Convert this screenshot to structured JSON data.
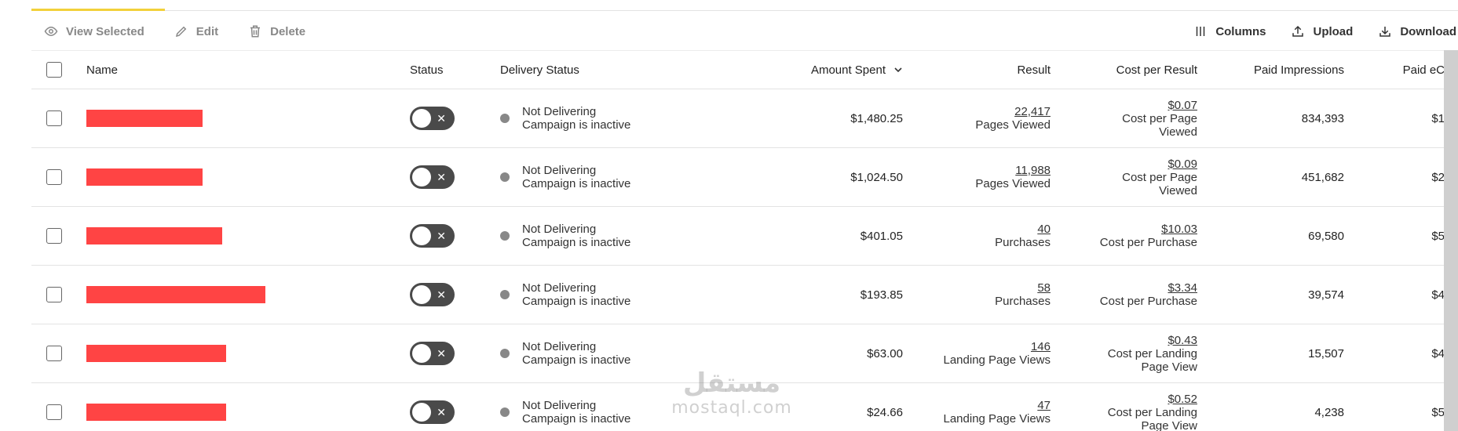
{
  "toolbar": {
    "view_selected": "View Selected",
    "edit": "Edit",
    "delete": "Delete",
    "columns": "Columns",
    "upload": "Upload",
    "download": "Download"
  },
  "columns": {
    "name": "Name",
    "status": "Status",
    "delivery_status": "Delivery Status",
    "amount_spent": "Amount Spent",
    "result": "Result",
    "cost_per_result": "Cost per Result",
    "paid_impressions": "Paid Impressions",
    "paid_ec": "Paid eC"
  },
  "rows": [
    {
      "delivery": "Not Delivering",
      "delivery_sub": "Campaign is inactive",
      "amount": "$1,480.25",
      "result": "22,417",
      "result_type": "Pages Viewed",
      "cpr": "$0.07",
      "cpr_line1": "Cost per Page",
      "cpr_line2": "Viewed",
      "impressions": "834,393",
      "paid_ec": "$1"
    },
    {
      "delivery": "Not Delivering",
      "delivery_sub": "Campaign is inactive",
      "amount": "$1,024.50",
      "result": "11,988",
      "result_type": "Pages Viewed",
      "cpr": "$0.09",
      "cpr_line1": "Cost per Page",
      "cpr_line2": "Viewed",
      "impressions": "451,682",
      "paid_ec": "$2"
    },
    {
      "delivery": "Not Delivering",
      "delivery_sub": "Campaign is inactive",
      "amount": "$401.05",
      "result": "40",
      "result_type": "Purchases",
      "cpr": "$10.03",
      "cpr_line1": "Cost per Purchase",
      "cpr_line2": "",
      "impressions": "69,580",
      "paid_ec": "$5"
    },
    {
      "delivery": "Not Delivering",
      "delivery_sub": "Campaign is inactive",
      "amount": "$193.85",
      "result": "58",
      "result_type": "Purchases",
      "cpr": "$3.34",
      "cpr_line1": "Cost per Purchase",
      "cpr_line2": "",
      "impressions": "39,574",
      "paid_ec": "$4"
    },
    {
      "delivery": "Not Delivering",
      "delivery_sub": "Campaign is inactive",
      "amount": "$63.00",
      "result": "146",
      "result_type": "Landing Page Views",
      "cpr": "$0.43",
      "cpr_line1": "Cost per Landing",
      "cpr_line2": "Page View",
      "impressions": "15,507",
      "paid_ec": "$4"
    },
    {
      "delivery": "Not Delivering",
      "delivery_sub": "Campaign is inactive",
      "amount": "$24.66",
      "result": "47",
      "result_type": "Landing Page Views",
      "cpr": "$0.52",
      "cpr_line1": "Cost per Landing",
      "cpr_line2": "Page View",
      "impressions": "4,238",
      "paid_ec": "$5"
    }
  ],
  "watermark": {
    "arabic": "مستقل",
    "latin": "mostaql.com"
  }
}
